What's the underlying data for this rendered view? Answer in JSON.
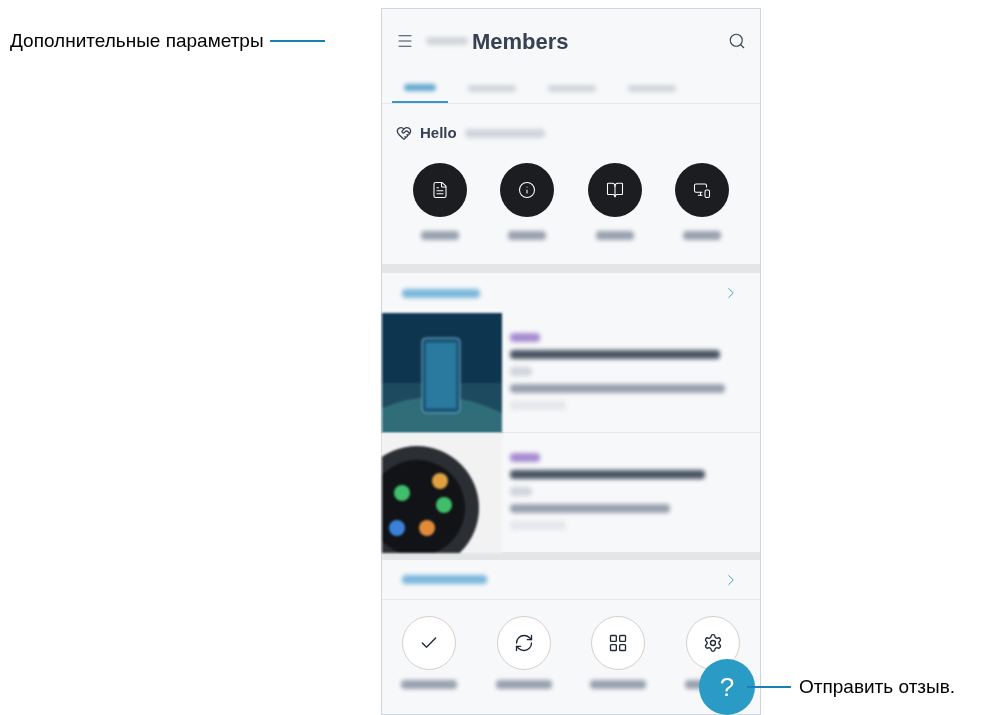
{
  "callout_left": {
    "text": "Дополнительные параметры"
  },
  "callout_right": {
    "text": "Отправить отзыв."
  },
  "app_bar": {
    "title": "Members"
  },
  "tabs": [
    {
      "selected": true
    },
    {
      "selected": false
    },
    {
      "selected": false
    },
    {
      "selected": false
    }
  ],
  "greeting": "Hello",
  "shortcuts": [
    {
      "kind": "document"
    },
    {
      "kind": "info"
    },
    {
      "kind": "faq"
    },
    {
      "kind": "devices"
    }
  ],
  "diagnostics": [
    {
      "kind": "check"
    },
    {
      "kind": "refresh"
    },
    {
      "kind": "apps"
    },
    {
      "kind": "settings"
    }
  ],
  "fab": {
    "label": "?"
  }
}
